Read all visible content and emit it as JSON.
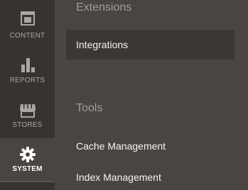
{
  "nav": {
    "items": [
      {
        "label": "CONTENT",
        "icon": "content-layout-icon"
      },
      {
        "label": "REPORTS",
        "icon": "bar-chart-icon"
      },
      {
        "label": "STORES",
        "icon": "storefront-icon"
      },
      {
        "label": "SYSTEM",
        "icon": "gear-icon",
        "active": true
      }
    ]
  },
  "panel": {
    "sections": [
      {
        "title": "Extensions",
        "links": [
          "Integrations"
        ]
      },
      {
        "title": "Tools",
        "links": [
          "Cache Management",
          "Index Management"
        ]
      }
    ]
  },
  "colors": {
    "nav_bg": "#373330",
    "panel_bg": "#4a4542",
    "hover_bg": "#3c3733",
    "section_title": "#a19c96",
    "link_text": "#f7f3ef"
  }
}
